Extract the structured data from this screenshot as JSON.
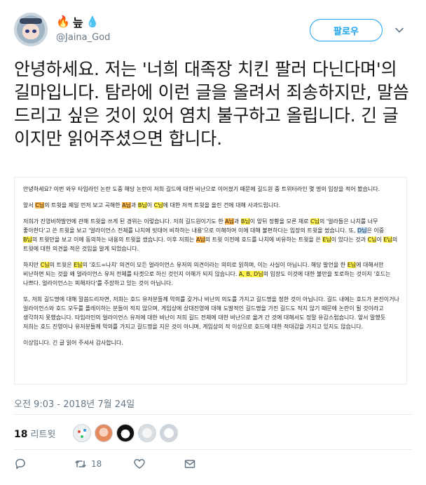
{
  "user": {
    "display_name": "늪",
    "handle": "@Jaina_God",
    "name_icons": [
      "fire-icon",
      "droplet-icon"
    ]
  },
  "follow_button": {
    "label": "팔로우"
  },
  "tweet": {
    "text": "안녕하세요. 저는 '너희 대족장 치킨 팔러 다닌다며'의 길마입니다. 탐라에 이런 글을 올려서 죄송하지만, 말씀드리고 싶은 것이 있어 염치 불구하고 올립니다. 긴 글이지만 읽어주셨으면 합니다."
  },
  "media": {
    "p1": "안녕하세요? 이번 와우 타임라인 논란 도중 해당 논란이 저희 길드에 대한 비난으로 이어졌기 때문에 길드원 중 트위터라인 몇 명의 입장을 적어 봤습니다.",
    "p2": {
      "s1": "앞서 ",
      "h1": "C님",
      "s2": "의 트윗을 제일 먼저 보고 곡해한 ",
      "h2": "A님",
      "s3": "과 ",
      "h3": "B님",
      "s4": "이 ",
      "h4": "C님",
      "s5": "에 대한 저격 트윗을 올린 건에 대해 사과드립니다."
    },
    "p3": {
      "s1": "저희가 진영비하발언에 관해 트윗을 쓰게 된 경위는 이렇습니다. 저희 길드원이기도 한 ",
      "h1": "A님",
      "s2": "과 ",
      "h2": "B님",
      "s3": "이 앞뒤 정황을 모른 채로 ",
      "h3": "C님",
      "s4": "의 '얼라들은 나치를 너무 좋아한다'고 쓴 트윗을 보고 '얼라이언스 전체를 나치에 빗대어 비하하는 내용'으로 이해하여 이에 대해 불편하다는 입장의 트윗을 썼습니다. 또, ",
      "h4": "D님",
      "s5": "은 이중 ",
      "h5": "B님",
      "s6": "의 트윗만을 보고 이에 동의하는 내용의 트윗을 썼습니다. 이후 저희는 ",
      "h6": "A님",
      "s7": "의 트윗 이전에 호드를 나치에 비유하는 트윗을 쓴 ",
      "h7": "E님",
      "s8": "이 있다는 것과 ",
      "h8": "C님",
      "s9": "이 ",
      "h9": "E님",
      "s10": "의 트윗에 대한 의견을 적은 것임을 알게 되었습니다."
    },
    "p4": {
      "s1": "하지만 ",
      "h1": "C님",
      "s2": "의 트윗은 ",
      "h2": "E님",
      "s3": "의 '호드=나치' 의견이 모든 얼라이언스 유저의 의견이라는 의미로 읽히며, 이는 사실이 아닙니다. 해당 발언을 한 ",
      "h3": "E님",
      "s4": "에 대해서만 비난하면 되는 것을 왜 얼라이언스 유저 전체를 타겟으로 하신 것인지 이해가 되지 않습니다. ",
      "h4": "A, B, D님",
      "s5": "의 입장도 이것에 대한 불만을 토로하는 것이지 '호드는 나쁘다. 얼라이언스는 피해자다'를 주장하고 있는 것이 아닙니다."
    },
    "p5": "또, 저희 길드명에 대해 말씀드리자면, 저희는 호드 유저분들께 악의를 갖거나 비난의 의도를 가지고 길드명을 정한 것이 아닙니다. 길드 내에는 호드가 본진이거나 얼라이언스와 호드 모두를 플레이하는 분들이 적지 않으며, 게임상에 상대진영에 대해 도발적인 길드명을 가진 길드도 적지 않기 때문에 논란이 될 것이라고 생각하지 못했습니다. 타임라인의 얼라이언스 유저에 대한 비난이 저희 길드 전체에 대한 비난으로 옮겨 간 것에 대해서도 정말 유감스럽습니다. 앞서 말했듯 저희는 호드 진영이나 유저분들께 악의를 가지고 길드명을 지은 것이 아니며, 게임상의 적 이상으로 호드에 대한 적대감을 가지고 있지도 않습니다.",
    "p6": "이상입니다. 긴 글 읽어 주셔서 감사합니다."
  },
  "timestamp": "오전 9:03 - 2018년 7월 24일",
  "retweets": {
    "count": "18",
    "label": "리트윗"
  },
  "actions": {
    "reply_count": "",
    "retweet_count": "18",
    "like_count": ""
  },
  "colors": {
    "accent": "#1da1f2",
    "muted": "#657786",
    "highlight_yellow": "#fff04a",
    "highlight_orange": "#ffb74a",
    "highlight_blue": "#b6dafb"
  }
}
